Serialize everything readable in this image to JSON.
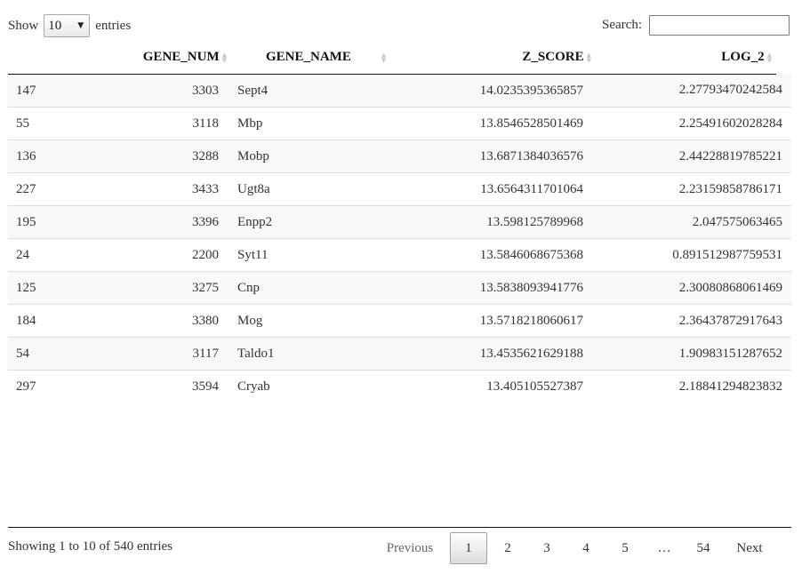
{
  "length_control": {
    "show_label": "Show",
    "selected": "10",
    "entries_label": "entries"
  },
  "search": {
    "label": "Search:",
    "value": ""
  },
  "table": {
    "columns": [
      "",
      "GENE_NUM",
      "GENE_NAME",
      "Z_SCORE",
      "LOG_2"
    ],
    "rows": [
      [
        "147",
        "3303",
        "Sept4",
        "14.0235395365857",
        "2.27793470242584"
      ],
      [
        "55",
        "3118",
        "Mbp",
        "13.8546528501469",
        "2.25491602028284"
      ],
      [
        "136",
        "3288",
        "Mobp",
        "13.6871384036576",
        "2.44228819785221"
      ],
      [
        "227",
        "3433",
        "Ugt8a",
        "13.6564311701064",
        "2.23159858786171"
      ],
      [
        "195",
        "3396",
        "Enpp2",
        "13.598125789968",
        "2.047575063465"
      ],
      [
        "24",
        "2200",
        "Syt11",
        "13.5846068675368",
        "0.891512987759531"
      ],
      [
        "125",
        "3275",
        "Cnp",
        "13.5838093941776",
        "2.30080868061469"
      ],
      [
        "184",
        "3380",
        "Mog",
        "13.5718218060617",
        "2.36437872917643"
      ],
      [
        "54",
        "3117",
        "Taldo1",
        "13.4535621629188",
        "1.90983151287652"
      ],
      [
        "297",
        "3594",
        "Cryab",
        "13.405105527387",
        "2.18841294823832"
      ]
    ]
  },
  "info": "Showing 1 to 10 of 540 entries",
  "pagination": {
    "previous": "Previous",
    "pages": [
      "1",
      "2",
      "3",
      "4",
      "5"
    ],
    "ellipsis": "…",
    "last_page": "54",
    "next": "Next",
    "current": "1"
  },
  "icons": {
    "sort": "sort-both-icon",
    "dropdown": "chevron-down-icon"
  },
  "colors": {
    "striped_row": "#f9f9f9",
    "row_border": "#dddddd",
    "header_border": "#111111"
  }
}
